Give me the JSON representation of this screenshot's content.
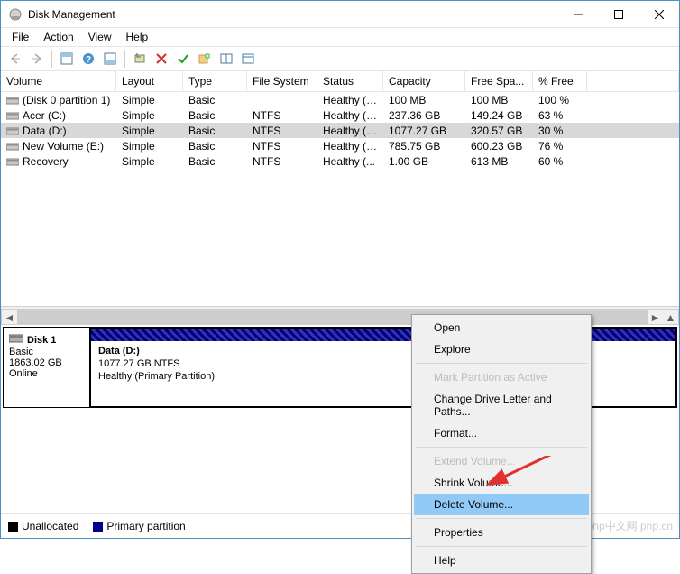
{
  "window": {
    "title": "Disk Management"
  },
  "menu": {
    "file": "File",
    "action": "Action",
    "view": "View",
    "help": "Help"
  },
  "columns": {
    "volume": "Volume",
    "layout": "Layout",
    "type": "Type",
    "filesystem": "File System",
    "status": "Status",
    "capacity": "Capacity",
    "freespace": "Free Spa...",
    "pctfree": "% Free"
  },
  "volumes": [
    {
      "name": "(Disk 0 partition 1)",
      "layout": "Simple",
      "type": "Basic",
      "fs": "",
      "status": "Healthy (E...",
      "cap": "100 MB",
      "free": "100 MB",
      "pct": "100 %",
      "selected": false
    },
    {
      "name": "Acer (C:)",
      "layout": "Simple",
      "type": "Basic",
      "fs": "NTFS",
      "status": "Healthy (B...",
      "cap": "237.36 GB",
      "free": "149.24 GB",
      "pct": "63 %",
      "selected": false
    },
    {
      "name": "Data (D:)",
      "layout": "Simple",
      "type": "Basic",
      "fs": "NTFS",
      "status": "Healthy (P...",
      "cap": "1077.27 GB",
      "free": "320.57 GB",
      "pct": "30 %",
      "selected": true
    },
    {
      "name": "New Volume (E:)",
      "layout": "Simple",
      "type": "Basic",
      "fs": "NTFS",
      "status": "Healthy (P...",
      "cap": "785.75 GB",
      "free": "600.23 GB",
      "pct": "76 %",
      "selected": false
    },
    {
      "name": "Recovery",
      "layout": "Simple",
      "type": "Basic",
      "fs": "NTFS",
      "status": "Healthy (...",
      "cap": "1.00 GB",
      "free": "613 MB",
      "pct": "60 %",
      "selected": false
    }
  ],
  "disk": {
    "name": "Disk 1",
    "type": "Basic",
    "size": "1863.02 GB",
    "status": "Online",
    "partition": {
      "title": "Data  (D:)",
      "line1": "1077.27 GB NTFS",
      "line2": "Healthy (Primary Partition)"
    }
  },
  "legend": {
    "unallocated": "Unallocated",
    "primary": "Primary partition"
  },
  "context": {
    "open": "Open",
    "explore": "Explore",
    "mark": "Mark Partition as Active",
    "change": "Change Drive Letter and Paths...",
    "format": "Format...",
    "extend": "Extend Volume...",
    "shrink": "Shrink Volume...",
    "delete": "Delete Volume...",
    "properties": "Properties",
    "help": "Help"
  },
  "watermark": "php中文网 php.cn"
}
